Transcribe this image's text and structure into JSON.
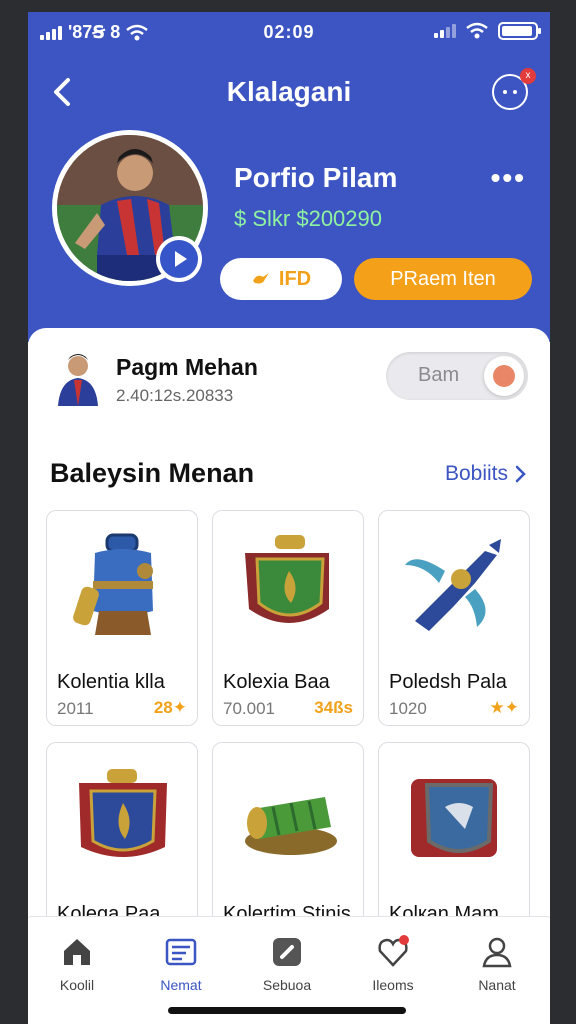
{
  "status_bar": {
    "left_text": "'87Ꞩ 8",
    "time": "02:09"
  },
  "header": {
    "title": "Klalagani",
    "notification_badge": "x"
  },
  "profile": {
    "name": "Porfio Pilam",
    "balance": "$ Slkr $200290",
    "more_label": "•••",
    "btn_primary": "IFD",
    "btn_secondary": "PRaem Iten"
  },
  "user_row": {
    "name": "Pagm Mehan",
    "id": "2.40:12s.20833",
    "toggle_label": "Bam"
  },
  "section": {
    "title": "Baleysin Menan",
    "link": "Bobiits"
  },
  "items": [
    {
      "name": "Kolentia klla",
      "year": "2011",
      "badge": "28✦",
      "icon": "sack-blue"
    },
    {
      "name": "Koleхia Baa",
      "year": "70.001",
      "badge": "34ßs",
      "icon": "shield-green"
    },
    {
      "name": "Poledsh Pala",
      "year": "1020",
      "badge": "★✦",
      "icon": "dragon"
    },
    {
      "name": "Kolega Paa",
      "year": "",
      "badge": "",
      "icon": "chest-red"
    },
    {
      "name": "Kolertim Stinis",
      "year": "",
      "badge": "",
      "icon": "green-roll"
    },
    {
      "name": "Kolкan Mam",
      "year": "",
      "badge": "",
      "icon": "chest-shield"
    }
  ],
  "nav": [
    {
      "label": "Koolil",
      "icon": "home-icon",
      "active": false
    },
    {
      "label": "Nemat",
      "icon": "document-icon",
      "active": true
    },
    {
      "label": "Sebuoa",
      "icon": "tag-icon",
      "active": false
    },
    {
      "label": "Ileoms",
      "icon": "heart-icon",
      "active": false
    },
    {
      "label": "Nanat",
      "icon": "user-icon",
      "active": false
    }
  ],
  "colors": {
    "primary": "#3d55c2",
    "accent": "#f5a019",
    "balance": "#8ff2a0"
  }
}
